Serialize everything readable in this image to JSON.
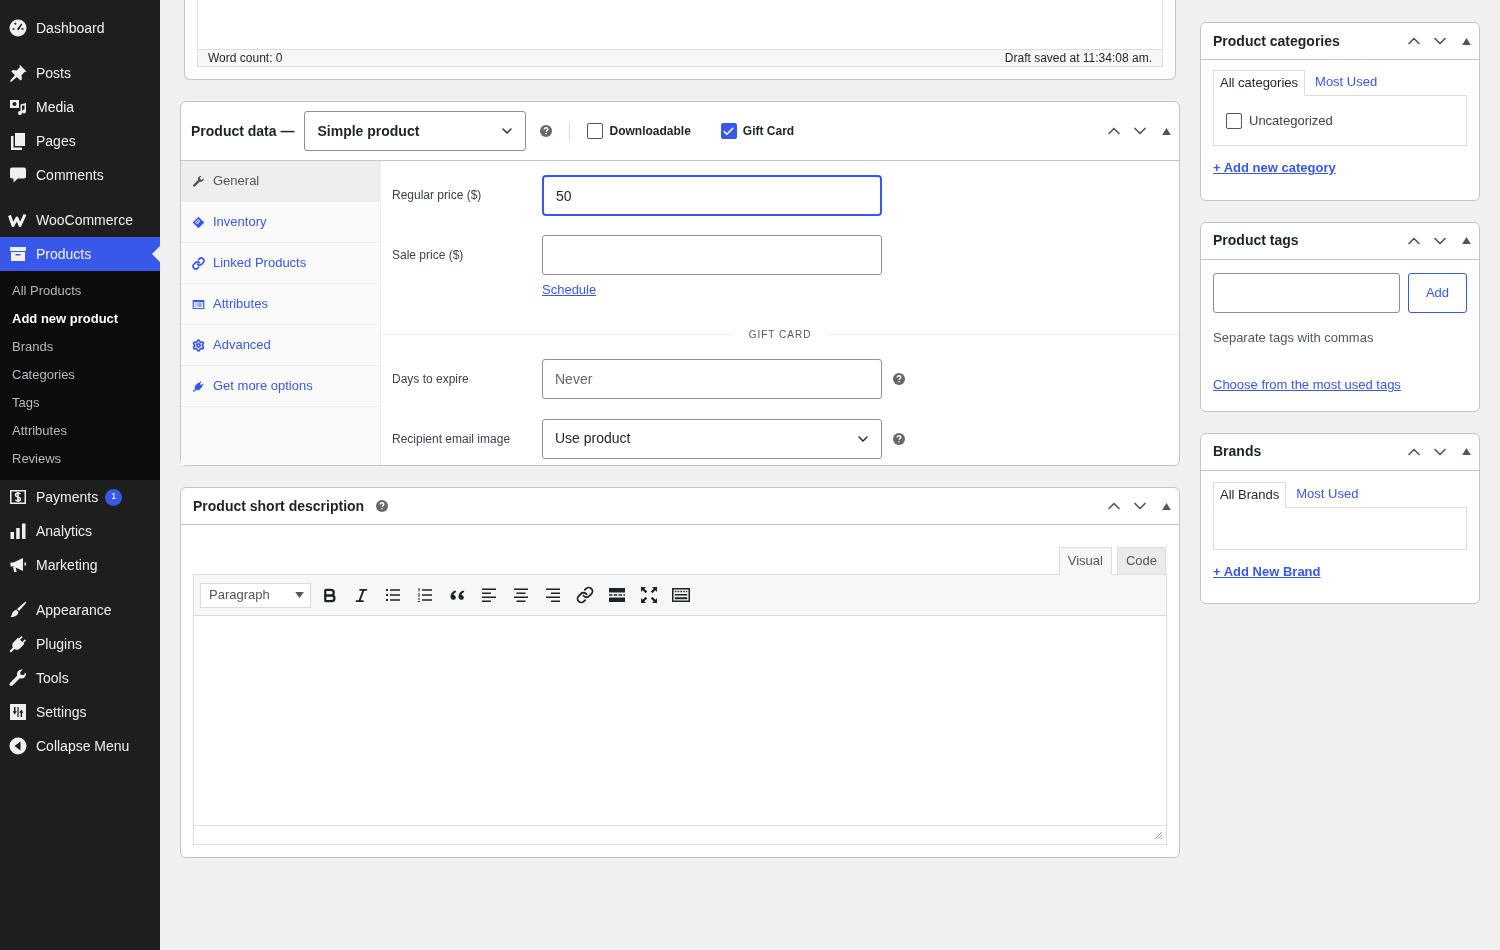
{
  "admin_menu": {
    "sections": [
      {
        "items": [
          {
            "label": "Dashboard",
            "selected": false
          }
        ]
      },
      {
        "items": [
          {
            "label": "Posts",
            "selected": false
          },
          {
            "label": "Media",
            "selected": false
          },
          {
            "label": "Pages",
            "selected": false
          },
          {
            "label": "Comments",
            "selected": false
          }
        ]
      },
      {
        "items": [
          {
            "label": "WooCommerce",
            "selected": false
          },
          {
            "label": "Products",
            "selected": true,
            "children": [
              {
                "label": "All Products",
                "selected": false
              },
              {
                "label": "Add new product",
                "selected": true
              },
              {
                "label": "Brands",
                "selected": false
              },
              {
                "label": "Categories",
                "selected": false
              },
              {
                "label": "Tags",
                "selected": false
              },
              {
                "label": "Attributes",
                "selected": false
              },
              {
                "label": "Reviews",
                "selected": false
              }
            ]
          },
          {
            "label": "Payments",
            "selected": false,
            "badge": "1"
          },
          {
            "label": "Analytics",
            "selected": false
          },
          {
            "label": "Marketing",
            "selected": false
          }
        ]
      },
      {
        "items": [
          {
            "label": "Appearance",
            "selected": false
          },
          {
            "label": "Plugins",
            "selected": false
          },
          {
            "label": "Tools",
            "selected": false
          },
          {
            "label": "Settings",
            "selected": false
          }
        ]
      }
    ],
    "collapse": {
      "label": "Collapse Menu"
    }
  },
  "content_editor": {
    "word_count": "Word count: 0",
    "save_status": "Draft saved at 11:34:08 am."
  },
  "product_data": {
    "title": "Product data —",
    "product_type": {
      "value": "Simple product"
    },
    "options": [
      {
        "label": "Downloadable",
        "checked": false
      },
      {
        "label": "Gift Card",
        "checked": true
      }
    ],
    "tabs": [
      {
        "label": "General",
        "selected": true
      },
      {
        "label": "Inventory",
        "selected": false
      },
      {
        "label": "Linked Products",
        "selected": false
      },
      {
        "label": "Attributes",
        "selected": false
      },
      {
        "label": "Advanced",
        "selected": false
      },
      {
        "label": "Get more options",
        "selected": false
      }
    ],
    "pricing_fields": [
      {
        "label": "Regular price ($)",
        "value": "50",
        "focused": true
      },
      {
        "label": "Sale price ($)",
        "focused": false,
        "link": "Schedule"
      }
    ],
    "gift_card": {
      "heading": "GIFT CARD",
      "fields": [
        {
          "kind": "text",
          "label": "Days to expire",
          "placeholder": "Never"
        },
        {
          "kind": "select",
          "label": "Recipient email image",
          "value": "Use product"
        }
      ]
    }
  },
  "short_description": {
    "title": "Product short description",
    "editor_tabs": [
      {
        "label": "Visual",
        "selected": true
      },
      {
        "label": "Code",
        "selected": false
      }
    ],
    "format": {
      "value": "Paragraph"
    }
  },
  "product_categories": {
    "title": "Product categories",
    "tabs": [
      {
        "label": "All categories",
        "selected": true
      },
      {
        "label": "Most Used",
        "selected": false
      }
    ],
    "categories": [
      {
        "label": "Uncategorized",
        "checked": false
      }
    ],
    "add_link": "+ Add new category"
  },
  "product_tags": {
    "title": "Product tags",
    "add_button": "Add",
    "hint": "Separate tags with commas",
    "link": "Choose from the most used tags"
  },
  "brands": {
    "title": "Brands",
    "tabs": [
      {
        "label": "All Brands",
        "selected": true
      },
      {
        "label": "Most Used",
        "selected": false
      }
    ],
    "add_link": "+ Add New Brand"
  }
}
